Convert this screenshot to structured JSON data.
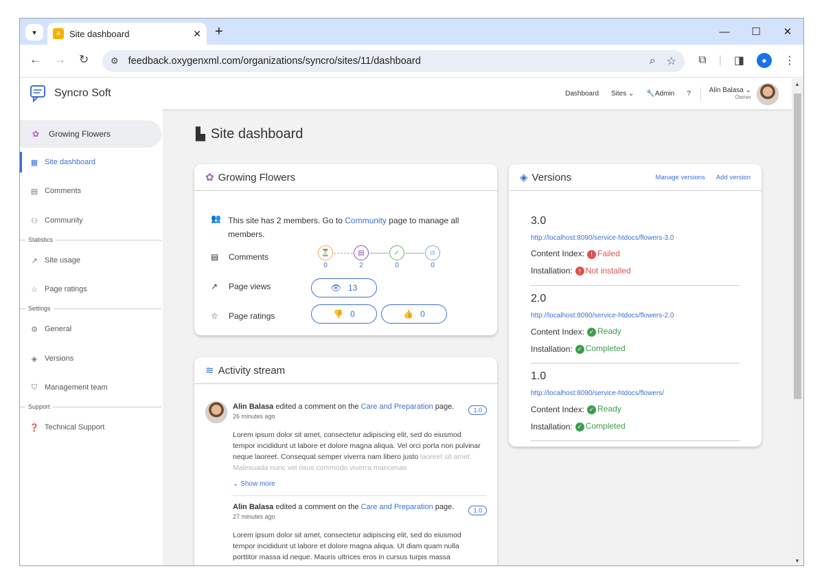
{
  "browser": {
    "tab_title": "Site dashboard",
    "url": "feedback.oxygenxml.com/organizations/syncro/sites/11/dashboard"
  },
  "header": {
    "brand": "Syncro Soft",
    "nav": {
      "dashboard": "Dashboard",
      "sites": "Sites",
      "admin": "Admin"
    },
    "user": {
      "name": "Alin Balasa",
      "role": "Owner"
    }
  },
  "sidebar": {
    "site_name": "Growing Flowers",
    "items": [
      {
        "label": "Site dashboard",
        "icon": "dashboard-icon"
      },
      {
        "label": "Comments",
        "icon": "comment-icon"
      },
      {
        "label": "Community",
        "icon": "people-icon"
      },
      {
        "label": "Site usage",
        "icon": "trending-icon"
      },
      {
        "label": "Page ratings",
        "icon": "star-icon"
      },
      {
        "label": "General",
        "icon": "gear-icon"
      },
      {
        "label": "Versions",
        "icon": "layers-icon"
      },
      {
        "label": "Management team",
        "icon": "shield-icon"
      },
      {
        "label": "Technical Support",
        "icon": "help-icon"
      }
    ],
    "sections": {
      "statistics": "Statistics",
      "settings": "Settings",
      "support": "Support"
    }
  },
  "main": {
    "title": "Site dashboard",
    "site_card": {
      "title": "Growing Flowers",
      "members_text_pre": "This site has 2 members. Go to",
      "members_link": "Community",
      "members_text_post": "page to manage all members.",
      "comments_label": "Comments",
      "comment_stages": [
        {
          "count": "0",
          "color": "#f0a94a"
        },
        {
          "count": "2",
          "color": "#8a4fb4"
        },
        {
          "count": "0",
          "color": "#5cb85c"
        },
        {
          "count": "0",
          "color": "#7fa7d8"
        }
      ],
      "page_views_label": "Page views",
      "page_views": "13",
      "page_ratings_label": "Page ratings",
      "thumbs_down": "0",
      "thumbs_up": "0"
    },
    "versions_card": {
      "title": "Versions",
      "manage_link": "Manage versions",
      "add_link": "Add version",
      "content_index_label": "Content Index:",
      "installation_label": "Installation:",
      "versions": [
        {
          "num": "3.0",
          "url": "http://localhost:8090/service-htdocs/flowers-3.0",
          "index": "Failed",
          "install": "Not installed"
        },
        {
          "num": "2.0",
          "url": "http://localhost:8090/service-htdocs/flowers-2.0",
          "index": "Ready",
          "install": "Completed"
        },
        {
          "num": "1.0",
          "url": "http://localhost:8090/service-htdocs/flowers/",
          "index": "Ready",
          "install": "Completed"
        }
      ]
    },
    "activity_card": {
      "title": "Activity stream",
      "entries": [
        {
          "user": "Alin Balasa",
          "action": "edited a comment on the",
          "page": "Care and Preparation",
          "suffix": "page.",
          "time": "26 minutes ago",
          "version": "1.0",
          "body": "Lorem ipsum dolor sit amet, consectetur adipiscing elit, sed do eiusmod tempor incididunt ut labore et dolore magna aliqua. Vel orci porta non pulvinar neque laoreet. Consequat semper viverra nam libero justo",
          "body_fade": "laoreet sit amet. Malesuada nunc vel risus commodo viverra maecenas",
          "show_more": "Show more"
        },
        {
          "user": "Alin Balasa",
          "action": "edited a comment on the",
          "page": "Care and Preparation",
          "suffix": "page.",
          "time": "27 minutes ago",
          "version": "1.0",
          "body": "Lorem ipsum dolor sit amet, consectetur adipiscing elit, sed do eiusmod tempor incididunt ut labore et dolore magna aliqua. Ut diam quam nulla porttitor massa id neque. Mauris ultrices eros in cursus turpis massa"
        }
      ]
    }
  }
}
